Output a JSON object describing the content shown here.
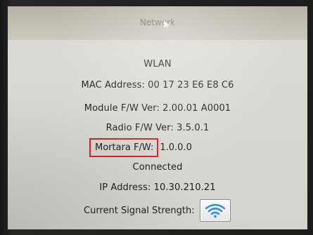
{
  "header": {
    "title": "Network"
  },
  "network": {
    "section": "WLAN",
    "mac_address": "MAC Address: 00 17 23 E6 E8 C6",
    "module_fw": "Module F/W Ver: 2.00.01 A0001",
    "radio_fw": "Radio F/W Ver: 3.5.0.1",
    "mortara_fw_label": "Mortara F/W:",
    "mortara_fw_value": "1.0.0.0",
    "status": "Connected",
    "ip_address": "IP Address: 10.30.210.21",
    "signal_label": "Current Signal Strength:",
    "signal_icon": "wifi-signal-icon"
  },
  "colors": {
    "highlight": "#d2232a",
    "wifi": "#3a8fd8",
    "title_text": "#7f7660"
  }
}
